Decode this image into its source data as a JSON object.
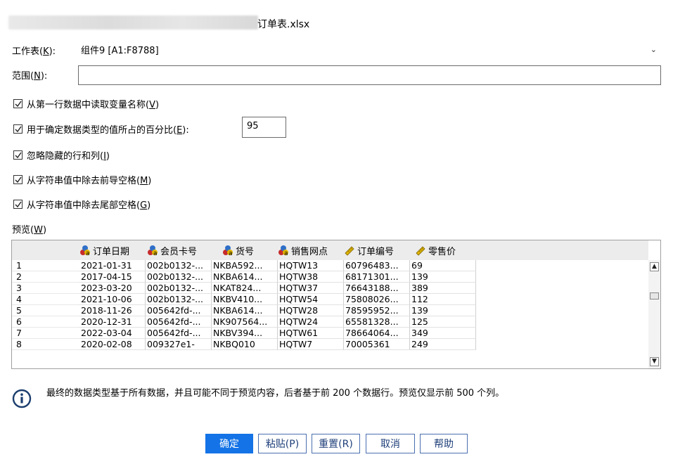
{
  "file": {
    "name_suffix": "订单表.xlsx"
  },
  "worksheet": {
    "label": "工作表(",
    "key": "K",
    "label_end": "):",
    "value": "组件9 [A1:F8788]"
  },
  "range": {
    "label": "范围(",
    "key": "N",
    "label_end": "):",
    "value": ""
  },
  "options": [
    {
      "text": "从第一行数据中读取变量名称(",
      "key": "V",
      "end": ")",
      "checked": true
    },
    {
      "text": "用于确定数据类型的值所占的百分比(",
      "key": "E",
      "end": "):",
      "checked": true
    },
    {
      "text": "忽略隐藏的行和列(",
      "key": "I",
      "end": ")",
      "checked": true
    },
    {
      "text": "从字符串值中除去前导空格(",
      "key": "M",
      "end": ")",
      "checked": true
    },
    {
      "text": "从字符串值中除去尾部空格(",
      "key": "G",
      "end": ")",
      "checked": true
    }
  ],
  "percent_value": "95",
  "preview": {
    "label": "预览(",
    "key": "W",
    "label_end": ")",
    "columns": [
      {
        "name": "订单日期",
        "icon": "string-variable-icon"
      },
      {
        "name": "会员卡号",
        "icon": "string-variable-icon"
      },
      {
        "name": "货号",
        "icon": "string-variable-icon"
      },
      {
        "name": "销售网点",
        "icon": "string-variable-icon"
      },
      {
        "name": "订单编号",
        "icon": "scale-variable-icon"
      },
      {
        "name": "零售价",
        "icon": "scale-variable-icon"
      }
    ],
    "rows": [
      [
        "1",
        "2021-01-31",
        "002b0132-...",
        "NKBA592...",
        "HQTW13",
        "60796483...",
        "69"
      ],
      [
        "2",
        "2017-04-15",
        "002b0132-...",
        "NKBA614...",
        "HQTW38",
        "68171301...",
        "139"
      ],
      [
        "3",
        "2023-03-20",
        "002b0132-...",
        "NKAT824...",
        "HQTW37",
        "76643188...",
        "389"
      ],
      [
        "4",
        "2021-10-06",
        "002b0132-...",
        "NKBV410...",
        "HQTW54",
        "75808026...",
        "112"
      ],
      [
        "5",
        "2018-11-26",
        "005642fd-...",
        "NKBA614...",
        "HQTW28",
        "78595952...",
        "139"
      ],
      [
        "6",
        "2020-12-31",
        "005642fd-...",
        "NK907564...",
        "HQTW24",
        "65581328...",
        "125"
      ],
      [
        "7",
        "2022-03-04",
        "005642fd-...",
        "NKBV394...",
        "HQTW61",
        "78664064...",
        "349"
      ],
      [
        "8",
        "2020-02-08",
        "009327e1-",
        "NKBQ010",
        "HQTW7",
        "70005361",
        "249"
      ]
    ]
  },
  "info": "最终的数据类型基于所有数据，并且可能不同于预览内容，后者基于前 200 个数据行。预览仅显示前 500 个列。",
  "buttons": {
    "ok": "确定",
    "paste": "粘贴(P)",
    "reset": "重置(R)",
    "cancel": "取消",
    "help": "帮助"
  },
  "colors": {
    "primary": "#1473e6",
    "icon_blue": "#2f6fc8",
    "icon_red": "#c62b2b",
    "icon_yellow": "#e0b400"
  }
}
